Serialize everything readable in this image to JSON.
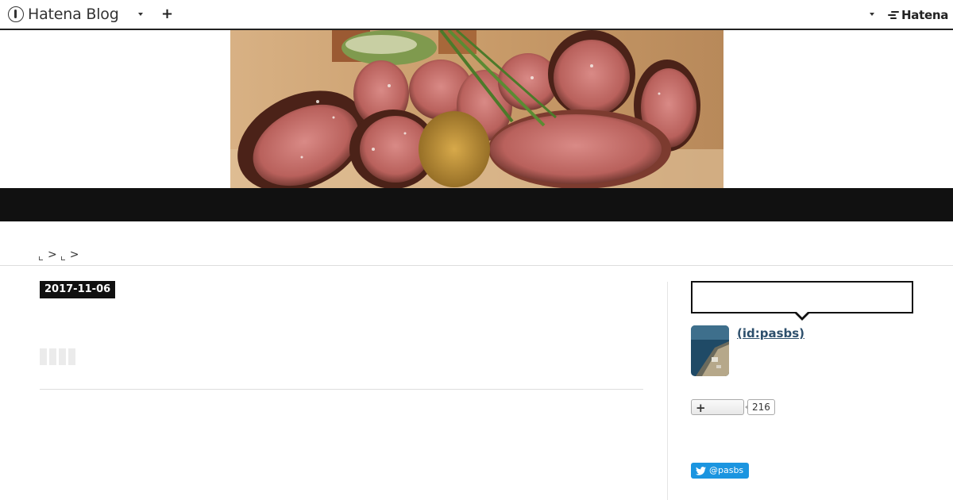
{
  "topbar": {
    "logo_text": "Hatena Blog",
    "add_label": "+",
    "brand_text": "Hatena",
    "icons": [
      "hatena-blog-logo-icon",
      "chevron-down-icon",
      "plus-icon",
      "hatena-logo-icon"
    ]
  },
  "breadcrumb": {
    "separators": [
      ">",
      ">"
    ]
  },
  "entry": {
    "date": "2017-11-06"
  },
  "sidebar": {
    "profile_id": " (id:pasbs)",
    "bookmark_add_label": "+",
    "bookmark_count": "216",
    "twitter_follow_label": "@pasbs"
  },
  "colors": {
    "band": "#111111",
    "link": "#2d4f6c",
    "twitter": "#1b95e0"
  }
}
